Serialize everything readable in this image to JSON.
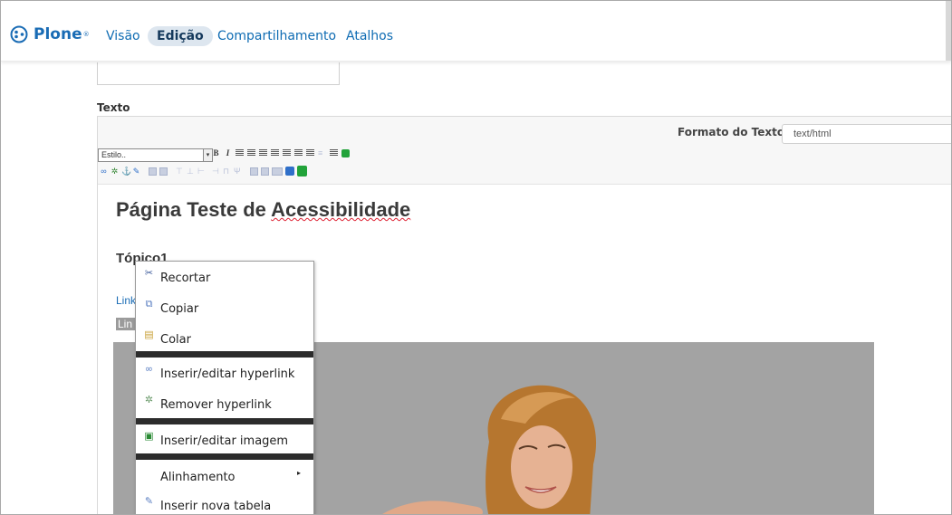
{
  "toolbar": {
    "logo_text": "Plone",
    "logo_mark": "®",
    "tabs": [
      {
        "label": "Visão",
        "active": false
      },
      {
        "label": "Edição",
        "active": true
      },
      {
        "label": "Compartilhamento",
        "active": false
      },
      {
        "label": "Atalhos",
        "active": false
      }
    ]
  },
  "form": {
    "text_label": "Texto",
    "format_label": "Formato do Texto",
    "format_value": "text/html"
  },
  "editor_toolbar": {
    "style_select": "Estilo..",
    "bold": "B",
    "italic": "I"
  },
  "content": {
    "heading1_prefix": "Página Teste de ",
    "heading1_spell": "Acessibilidade",
    "heading2": "Tópico1",
    "link1_fragment": "Link",
    "link2_fragment": "Lin"
  },
  "context_menu": {
    "items": [
      {
        "label": "Recortar",
        "icon": "scissors-icon"
      },
      {
        "label": "Copiar",
        "icon": "copy-icon"
      },
      {
        "label": "Colar",
        "icon": "paste-icon"
      },
      {
        "label": "Inserir/editar hyperlink",
        "icon": "link-icon"
      },
      {
        "label": "Remover hyperlink",
        "icon": "unlink-icon"
      },
      {
        "label": "Inserir/editar imagem",
        "icon": "image-icon"
      },
      {
        "label": "Alinhamento",
        "icon": "none",
        "submenu_arrow": "▸"
      },
      {
        "label": "Inserir nova tabela",
        "icon": "table-icon"
      }
    ]
  },
  "colors": {
    "brand": "#1a6cb5",
    "active_tab_bg": "#dde6ef",
    "photo_bg": "#a3a3a3",
    "separator": "#2c2c2c"
  }
}
